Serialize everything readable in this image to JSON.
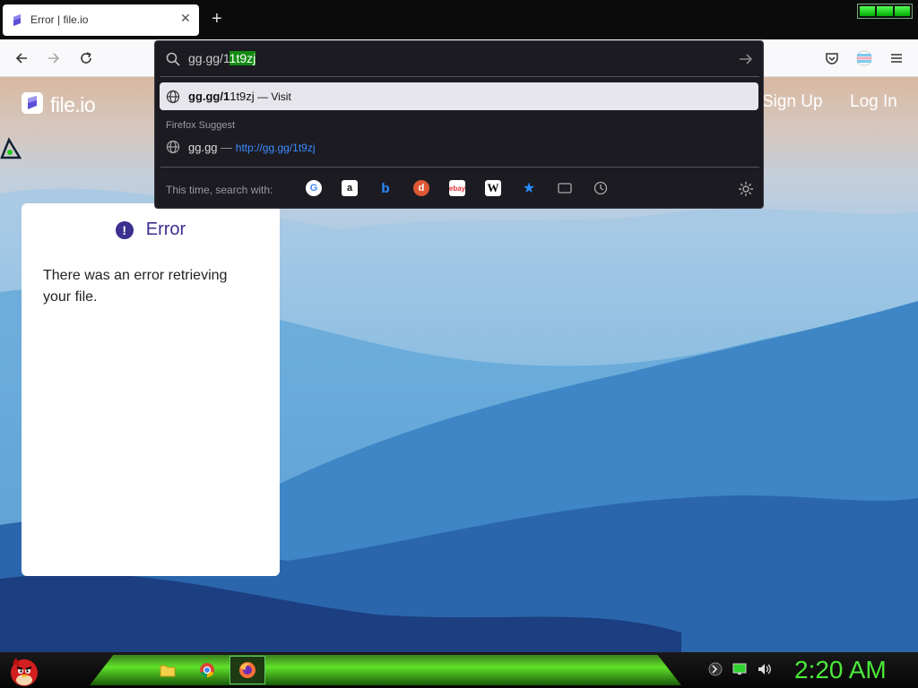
{
  "browser": {
    "tab_title": "Error | file.io",
    "tab_close": "✕",
    "new_tab": "+",
    "url_typed": "gg.gg/1",
    "url_selected": "1t9zj"
  },
  "dropdown": {
    "result1_bold": "gg.gg/1",
    "result1_rest": "1t9zj",
    "result1_visit": " — Visit",
    "suggest_label": "Firefox Suggest",
    "result2_text": "gg.gg",
    "result2_sep": " — ",
    "result2_link": "http://gg.gg/1t9zj",
    "search_with_label": "This time, search with:",
    "engines": [
      "google-icon",
      "amazon-icon",
      "bing-icon",
      "duckduckgo-icon",
      "ebay-icon",
      "wikipedia-icon",
      "bookmarks-icon",
      "tabs-icon",
      "history-icon"
    ]
  },
  "site": {
    "logo_text": "file.io",
    "signup": "Sign Up",
    "login": "Log In"
  },
  "card": {
    "title": "Error",
    "message": "There was an error retrieving your file."
  },
  "taskbar": {
    "clock": "2:20 AM"
  },
  "colors": {
    "accent": "#3b2f8f",
    "selection": "#138a13",
    "clock": "#4be83b"
  }
}
